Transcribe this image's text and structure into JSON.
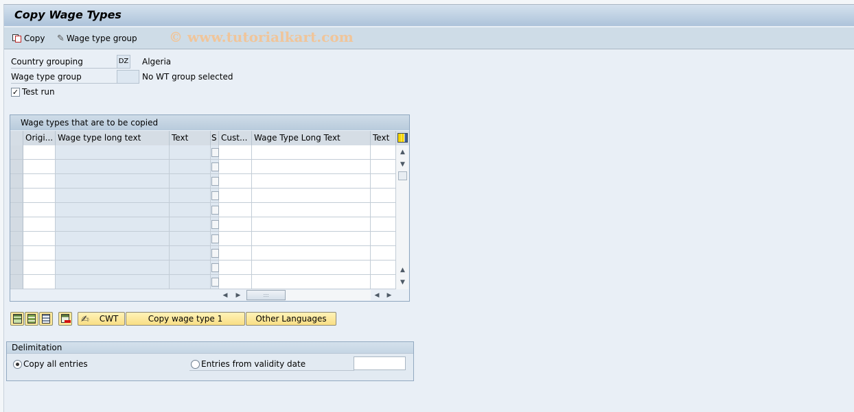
{
  "window": {
    "title": "Copy Wage Types"
  },
  "toolbar": {
    "copy_label": "Copy",
    "wage_type_group_label": "Wage type group",
    "watermark": "© www.tutorialkart.com"
  },
  "form": {
    "country_grouping": {
      "label": "Country grouping",
      "value": "DZ",
      "description": "Algeria"
    },
    "wage_type_group": {
      "label": "Wage type group",
      "value": "",
      "description": "No WT group selected"
    },
    "test_run": {
      "label": "Test run",
      "checked": true,
      "mark": "✓"
    }
  },
  "grid": {
    "title": "Wage types that are to be copied",
    "columns": [
      "Origi...",
      "Wage type long text",
      "Text",
      "S",
      "Cust...",
      "Wage Type Long Text",
      "Text"
    ],
    "row_count": 10,
    "rows": []
  },
  "buttons": {
    "cwt": "CWT",
    "copy_wage_type_1": "Copy wage type 1",
    "other_languages": "Other Languages"
  },
  "delimitation": {
    "title": "Delimitation",
    "copy_all_entries": {
      "label": "Copy all entries",
      "selected": true
    },
    "entries_from_validity_date": {
      "label": "Entries from validity date",
      "selected": false,
      "value": ""
    }
  }
}
